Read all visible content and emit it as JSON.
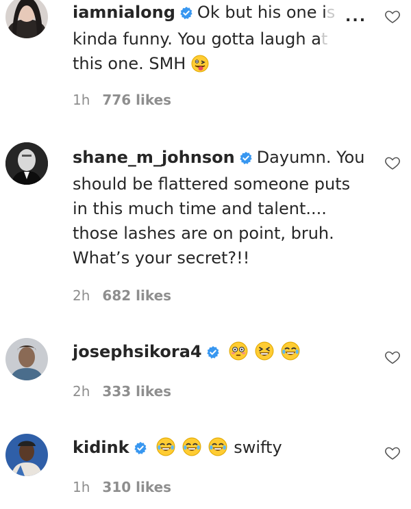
{
  "comments": [
    {
      "username": "iamnialong",
      "text": "Ok but his one is kinda funny. You gotta laugh at this one. SMH",
      "text_lines": [
        "Ok but his one i",
        "kinda funny. You gotta laugh a",
        "this one. SMH"
      ],
      "fade_tail": [
        "s",
        "t",
        ""
      ],
      "emojis": [
        "tongue-face"
      ],
      "time": "1h",
      "likes": "776 likes",
      "verified": true
    },
    {
      "username": "shane_m_johnson",
      "text": "Dayumn. You should be flattered someone puts in this much time and talent.... those lashes are on point, bruh. What’s your secret?!!",
      "time": "2h",
      "likes": "682 likes",
      "verified": true
    },
    {
      "username": "josephsikora4",
      "text": "",
      "emojis": [
        "flushed-face",
        "squinting-laugh-face",
        "tears-of-joy-face"
      ],
      "time": "2h",
      "likes": "333 likes",
      "verified": true
    },
    {
      "username": "kidink",
      "text": "swifty",
      "emojis": [
        "tears-of-joy-face",
        "tears-of-joy-face",
        "tears-of-joy-face"
      ],
      "time": "1h",
      "likes": "310 likes",
      "verified": true
    }
  ],
  "more_options_label": "...",
  "icons": {
    "verified": "verified-badge-icon",
    "like": "heart-outline-icon",
    "more": "more-options-icon"
  },
  "colors": {
    "verified_blue": "#3897f0",
    "meta_gray": "#8e8e8e",
    "text": "#262626"
  }
}
